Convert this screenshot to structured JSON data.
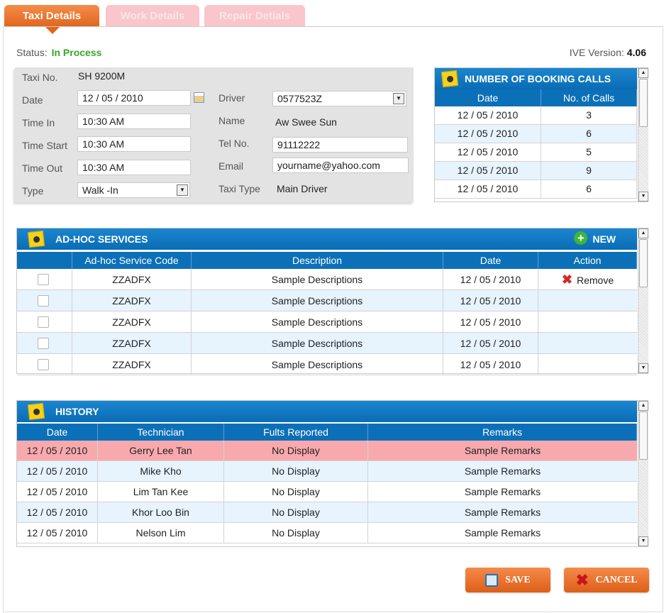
{
  "tabs": [
    {
      "label": "Taxi Details",
      "active": true
    },
    {
      "label": "Work Details",
      "active": false
    },
    {
      "label": "Repair Detials",
      "active": false
    }
  ],
  "status": {
    "label": "Status:",
    "value": "In Process"
  },
  "version": {
    "label": "IVE Version:",
    "value": "4.06"
  },
  "taxi": {
    "taxi_no_label": "Taxi No.",
    "taxi_no": "SH 9200M",
    "date_label": "Date",
    "date": "12 / 05 / 2010",
    "time_in_label": "Time In",
    "time_in": "10:30 AM",
    "time_start_label": "Time Start",
    "time_start": "10:30 AM",
    "time_out_label": "Time Out",
    "time_out": "10:30 AM",
    "type_label": "Type",
    "type": "Walk -In",
    "driver_label": "Driver",
    "driver": "0577523Z",
    "name_label": "Name",
    "name": "Aw Swee Sun",
    "tel_label": "Tel No.",
    "tel": "91112222",
    "email_label": "Email",
    "email": "yourname@yahoo.com",
    "taxi_type_label": "Taxi Type",
    "taxi_type": "Main Driver"
  },
  "booking": {
    "title": "NUMBER OF BOOKING CALLS",
    "columns": [
      "Date",
      "No. of Calls"
    ],
    "rows": [
      [
        "12 / 05 / 2010",
        "3"
      ],
      [
        "12 / 05 / 2010",
        "6"
      ],
      [
        "12 / 05 / 2010",
        "5"
      ],
      [
        "12 / 05 / 2010",
        "9"
      ],
      [
        "12 / 05 / 2010",
        "6"
      ]
    ]
  },
  "adhoc": {
    "title": "AD-HOC SERVICES",
    "new_label": "NEW",
    "columns": [
      "Ad-hoc Service Code",
      "Description",
      "Date",
      "Action"
    ],
    "remove_label": "Remove",
    "rows": [
      [
        "ZZADFX",
        "Sample Descriptions",
        "12 / 05 / 2010"
      ],
      [
        "ZZADFX",
        "Sample Descriptions",
        "12 / 05 / 2010"
      ],
      [
        "ZZADFX",
        "Sample Descriptions",
        "12 / 05 / 2010"
      ],
      [
        "ZZADFX",
        "Sample Descriptions",
        "12 / 05 / 2010"
      ],
      [
        "ZZADFX",
        "Sample Descriptions",
        "12 / 05 / 2010"
      ]
    ]
  },
  "history": {
    "title": "HISTORY",
    "columns": [
      "Date",
      "Technician",
      "Fults Reported",
      "Remarks"
    ],
    "rows": [
      [
        "12 / 05 / 2010",
        "Gerry Lee Tan",
        "No Display",
        "Sample Remarks"
      ],
      [
        "12 / 05 / 2010",
        "Mike Kho",
        "No Display",
        "Sample Remarks"
      ],
      [
        "12 / 05 / 2010",
        "Lim Tan Kee",
        "No Display",
        "Sample Remarks"
      ],
      [
        "12 / 05 / 2010",
        "Khor Loo Bin",
        "No Display",
        "Sample Remarks"
      ],
      [
        "12 / 05 / 2010",
        "Nelson Lim",
        "No Display",
        "Sample Remarks"
      ]
    ]
  },
  "buttons": {
    "save": "SAVE",
    "cancel": "CANCEL"
  }
}
